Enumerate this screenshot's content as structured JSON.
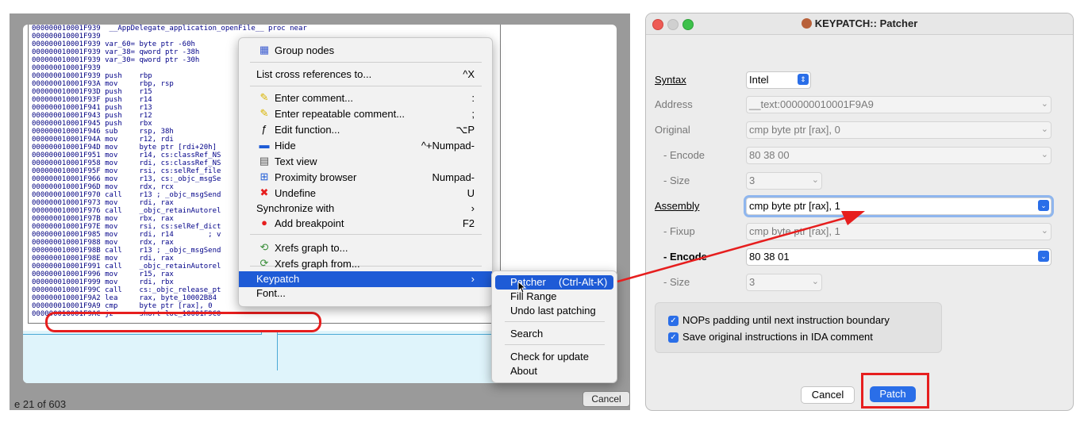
{
  "ida": {
    "asm_lines": [
      {
        "addr": "000000010001F939",
        "text": " __AppDelegate_application_openFile__ proc near"
      },
      {
        "addr": "000000010001F939",
        "text": ""
      },
      {
        "addr": "000000010001F939",
        "text": "var_60= byte ptr -60h"
      },
      {
        "addr": "000000010001F939",
        "text": "var_38= qword ptr -38h"
      },
      {
        "addr": "000000010001F939",
        "text": "var_30= qword ptr -30h"
      },
      {
        "addr": "000000010001F939",
        "text": ""
      },
      {
        "addr": "000000010001F939",
        "text": "push    rbp"
      },
      {
        "addr": "000000010001F93A",
        "text": "mov     rbp, rsp"
      },
      {
        "addr": "000000010001F93D",
        "text": "push    r15"
      },
      {
        "addr": "000000010001F93F",
        "text": "push    r14"
      },
      {
        "addr": "000000010001F941",
        "text": "push    r13"
      },
      {
        "addr": "000000010001F943",
        "text": "push    r12"
      },
      {
        "addr": "000000010001F945",
        "text": "push    rbx"
      },
      {
        "addr": "000000010001F946",
        "text": "sub     rsp, 38h"
      },
      {
        "addr": "000000010001F94A",
        "text": "mov     r12, rdi"
      },
      {
        "addr": "000000010001F94D",
        "text": "mov     byte ptr [rdi+20h]"
      },
      {
        "addr": "000000010001F951",
        "text": "mov     r14, cs:classRef_NS"
      },
      {
        "addr": "000000010001F958",
        "text": "mov     rdi, cs:classRef_NS"
      },
      {
        "addr": "000000010001F95F",
        "text": "mov     rsi, cs:selRef_file"
      },
      {
        "addr": "000000010001F966",
        "text": "mov     r13, cs:_objc_msgSe"
      },
      {
        "addr": "000000010001F96D",
        "text": "mov     rdx, rcx"
      },
      {
        "addr": "000000010001F970",
        "text": "call    r13 ; _objc_msgSend"
      },
      {
        "addr": "000000010001F973",
        "text": "mov     rdi, rax"
      },
      {
        "addr": "000000010001F976",
        "text": "call    _objc_retainAutorel"
      },
      {
        "addr": "000000010001F97B",
        "text": "mov     rbx, rax"
      },
      {
        "addr": "000000010001F97E",
        "text": "mov     rsi, cs:selRef_dict"
      },
      {
        "addr": "000000010001F985",
        "text": "mov     rdi, r14        ; v"
      },
      {
        "addr": "000000010001F988",
        "text": "mov     rdx, rax"
      },
      {
        "addr": "000000010001F98B",
        "text": "call    r13 ; _objc_msgSend"
      },
      {
        "addr": "000000010001F98E",
        "text": "mov     rdi, rax"
      },
      {
        "addr": "000000010001F991",
        "text": "call    _objc_retainAutorel"
      },
      {
        "addr": "000000010001F996",
        "text": "mov     r15, rax"
      },
      {
        "addr": "000000010001F999",
        "text": "mov     rdi, rbx"
      },
      {
        "addr": "000000010001F99C",
        "text": "call    cs:_objc_release_pt"
      },
      {
        "addr": "000000010001F9A2",
        "text": "lea     rax, byte_10002B84"
      },
      {
        "addr": "000000010001F9A9",
        "text": "cmp     byte ptr [rax], 0"
      },
      {
        "addr": "000000010001F9AC",
        "text": "jz      short loc_10001F9C0"
      }
    ],
    "status_line": "e 21 of 603",
    "bg_cancel_label": "Cancel"
  },
  "context_menu": {
    "items": [
      {
        "label": "Group nodes",
        "shortcut": "",
        "icon": "group-nodes-icon"
      },
      {
        "label": "List cross references to...",
        "shortcut": "^X",
        "icon": ""
      },
      {
        "label": "Enter comment...",
        "shortcut": ":",
        "icon": "comment-icon"
      },
      {
        "label": "Enter repeatable comment...",
        "shortcut": ";",
        "icon": "repeatable-comment-icon"
      },
      {
        "label": "Edit function...",
        "shortcut": "⌥P",
        "icon": "function-icon"
      },
      {
        "label": "Hide",
        "shortcut": "^+Numpad-",
        "icon": "hide-icon"
      },
      {
        "label": "Text view",
        "shortcut": "",
        "icon": "text-view-icon"
      },
      {
        "label": "Proximity browser",
        "shortcut": "Numpad-",
        "icon": "proximity-browser-icon"
      },
      {
        "label": "Undefine",
        "shortcut": "U",
        "icon": "undefine-icon"
      },
      {
        "label": "Synchronize with",
        "shortcut": "›",
        "icon": ""
      },
      {
        "label": "Add breakpoint",
        "shortcut": "F2",
        "icon": "breakpoint-icon"
      },
      {
        "label": "Xrefs graph to...",
        "shortcut": "",
        "icon": "xrefs-to-icon"
      },
      {
        "label": "Xrefs graph from...",
        "shortcut": "",
        "icon": "xrefs-from-icon"
      },
      {
        "label": "Keypatch",
        "shortcut": "›",
        "icon": ""
      },
      {
        "label": "Font...",
        "shortcut": "",
        "icon": ""
      }
    ]
  },
  "keypatch_submenu": {
    "patcher_label": "Patcher",
    "patcher_shortcut": "(Ctrl-Alt-K)",
    "fill_range": "Fill Range",
    "undo": "Undo last patching",
    "search": "Search",
    "check_update": "Check for update",
    "about": "About"
  },
  "dialog": {
    "title": "KEYPATCH:: Patcher",
    "syntax_label": "Syntax",
    "syntax_value": "Intel",
    "address_label": "Address",
    "address_value": "__text:000000010001F9A9",
    "original_label": "Original",
    "original_value": "cmp byte ptr [rax], 0",
    "orig_encode_label": "-  Encode",
    "orig_encode_value": "80 38 00",
    "orig_size_label": "-  Size",
    "orig_size_value": "3",
    "assembly_label": "Assembly",
    "assembly_value": "cmp byte ptr [rax], 1",
    "fixup_label": "-  Fixup",
    "fixup_value": "cmp byte ptr [rax], 1",
    "new_encode_label": "-  Encode",
    "new_encode_value": "80 38 01",
    "new_size_label": "-  Size",
    "new_size_value": "3",
    "nops_label": "NOPs padding until next instruction boundary",
    "save_label": "Save original instructions in IDA comment",
    "cancel_label": "Cancel",
    "patch_label": "Patch"
  },
  "colors": {
    "accent": "#2a6ee8",
    "highlight": "#e61e1e",
    "menu_selection": "#1e5bd6"
  }
}
